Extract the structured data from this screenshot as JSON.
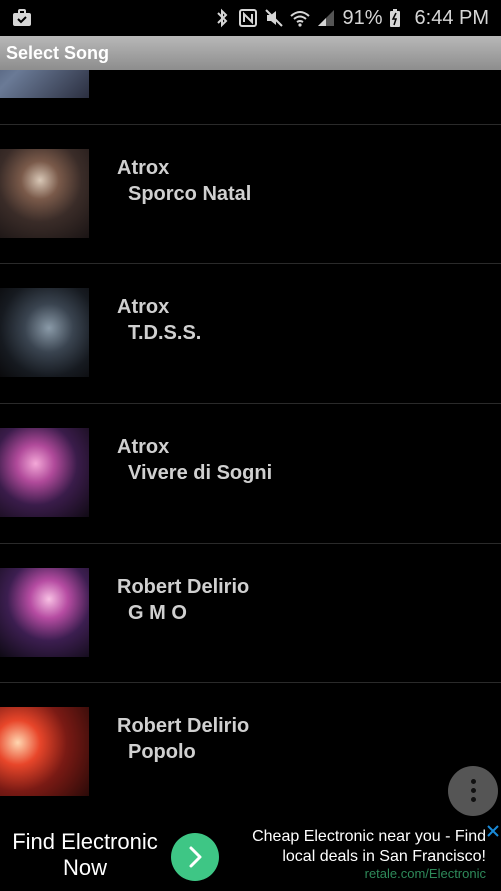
{
  "status_bar": {
    "battery": "91%",
    "time": "6:44 PM"
  },
  "title_bar": {
    "title": "Select Song"
  },
  "songs": [
    {
      "artist": "",
      "song": ""
    },
    {
      "artist": "Atrox",
      "song": "Sporco Natal"
    },
    {
      "artist": "Atrox",
      "song": "T.D.S.S."
    },
    {
      "artist": "Atrox",
      "song": "Vivere di Sogni"
    },
    {
      "artist": "Robert Delirio",
      "song": "G M O"
    },
    {
      "artist": "Robert Delirio",
      "song": "Popolo"
    }
  ],
  "ad": {
    "left_line1": "Find Electronic",
    "left_line2": "Now",
    "right_line1": "Cheap Electronic near you - Find",
    "right_line2": "local deals in San Francisco!",
    "url": "retale.com/Electronic"
  }
}
